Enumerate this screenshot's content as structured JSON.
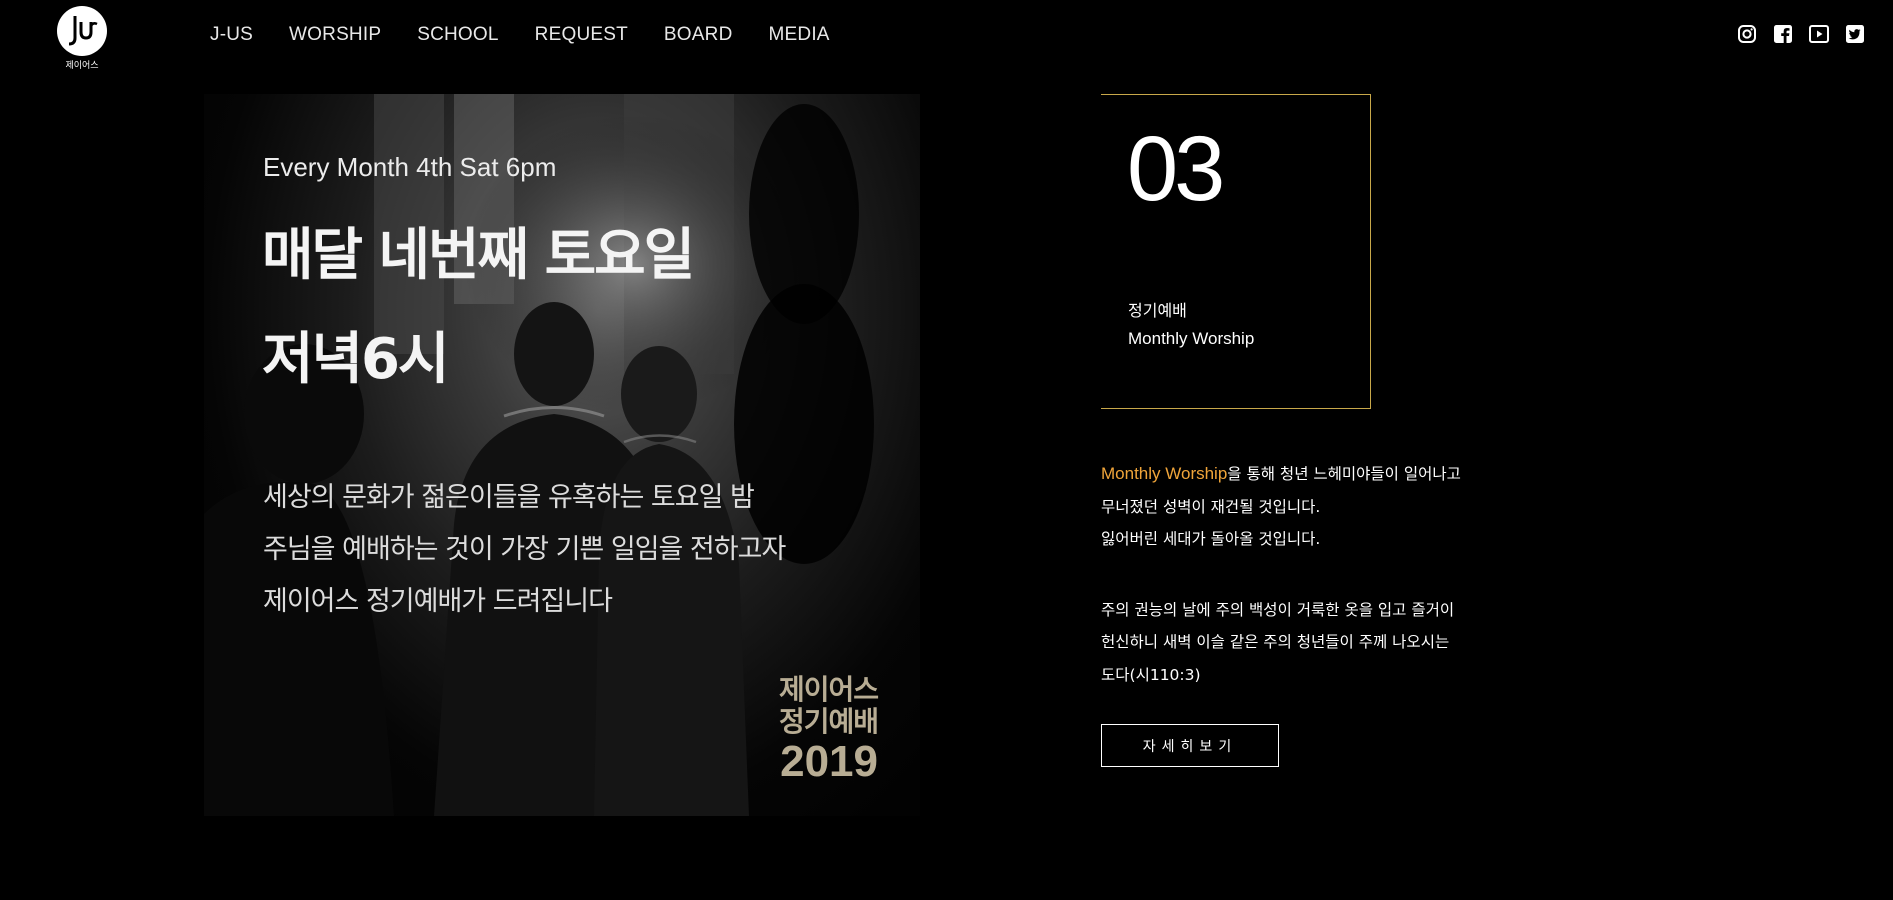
{
  "logo": {
    "text": "제이어스",
    "icon": "jus-logo-icon"
  },
  "nav": [
    "J-US",
    "WORSHIP",
    "SCHOOL",
    "REQUEST",
    "BOARD",
    "MEDIA"
  ],
  "social": [
    "instagram-icon",
    "facebook-icon",
    "youtube-icon",
    "twitter-icon"
  ],
  "hero": {
    "subtitle": "Every Month 4th Sat 6pm",
    "title": "매달 네번째 토요일\n저녁6시",
    "body": "세상의 문화가 젊은이들을 유혹하는 토요일 밤\n주님을 예배하는 것이 가장 기쁜 일임을 전하고자\n제이어스 정기예배가 드려집니다",
    "badge_line1": "제이어스",
    "badge_line2": "정기예배",
    "badge_year": "2019"
  },
  "card": {
    "number": "03",
    "korean": "정기예배",
    "english": "Monthly Worship"
  },
  "description": {
    "highlight": "Monthly Worship",
    "line1_rest": "을 통해 청년 느헤미야들이 일어나고",
    "line2": "무너졌던 성벽이 재건될 것입니다.",
    "line3": "잃어버린 세대가 돌아올 것입니다.",
    "line4": "주의 권능의 날에 주의 백성이 거룩한 옷을 입고 즐거이",
    "line5": "헌신하니 새벽 이슬 같은 주의 청년들이 주께 나오시는",
    "line6": "도다(시110:3)"
  },
  "button": {
    "label": "자세히보기"
  },
  "colors": {
    "accent": "#f0a53a",
    "border": "#c8a84a",
    "badge": "#b8ad94"
  }
}
